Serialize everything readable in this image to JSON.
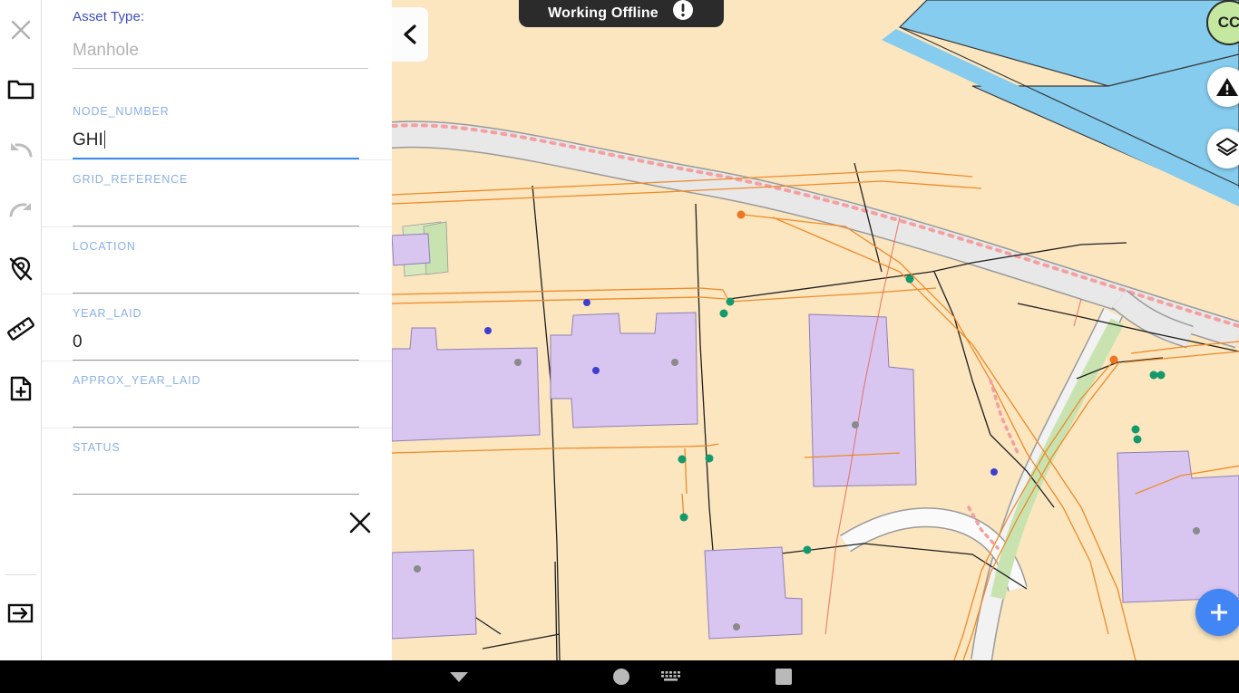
{
  "left_toolbar": {
    "items": [
      {
        "icon": "close-icon",
        "name": "close-tool"
      },
      {
        "icon": "folder-icon",
        "name": "folder-tool"
      },
      {
        "icon": "undo-icon",
        "name": "undo-tool"
      },
      {
        "icon": "redo-icon",
        "name": "redo-tool"
      },
      {
        "icon": "location-off-icon",
        "name": "location-off-tool"
      },
      {
        "icon": "ruler-icon",
        "name": "measure-tool"
      },
      {
        "icon": "add-document-icon",
        "name": "add-document-tool"
      },
      {
        "icon": "exit-icon",
        "name": "exit-tool"
      }
    ]
  },
  "form": {
    "asset_type_label": "Asset Type:",
    "asset_type_value": "Manhole",
    "asset_type_placeholder": "Manhole",
    "close_label": "✕",
    "fields": [
      {
        "label": "NODE_NUMBER",
        "value": "GHI",
        "focused": true
      },
      {
        "label": "GRID_REFERENCE",
        "value": "",
        "focused": false
      },
      {
        "label": "LOCATION",
        "value": "",
        "focused": false
      },
      {
        "label": "YEAR_LAID",
        "value": "0",
        "focused": false
      },
      {
        "label": "APPROX_YEAR_LAID",
        "value": "",
        "focused": false
      },
      {
        "label": "STATUS",
        "value": "",
        "focused": false
      }
    ]
  },
  "map_controls": {
    "back_icon": "chevron-left-icon",
    "offline_label": "Working Offline",
    "offline_icon": "exclamation-circle-icon",
    "avatar_initials": "CC",
    "warning_icon": "warning-triangle-icon",
    "layers_icon": "layers-icon",
    "add_icon": "plus-icon"
  },
  "nav_bar": {
    "back_icon": "triangle-down-icon",
    "home_icon": "circle-icon",
    "keyboard_icon": "keyboard-icon",
    "recents_icon": "square-icon"
  },
  "colors": {
    "accent_blue": "#3b8ce8",
    "label_blue": "#8ab0e8",
    "asset_label": "#3f4fc0",
    "fab_blue": "#4285f4",
    "map_background": "#fbe6c0",
    "map_building": "#d8c6f0",
    "map_road": "#e4e4e4",
    "map_water": "#85ccee",
    "map_green": "#c8e3b0",
    "utility_orange": "#f08a28",
    "node_green": "#13996b",
    "node_blue": "#3f3fcf",
    "node_gray": "#8a8a8a",
    "offline_banner": "#2b2b2b",
    "avatar_green": "#c5e8a0"
  }
}
